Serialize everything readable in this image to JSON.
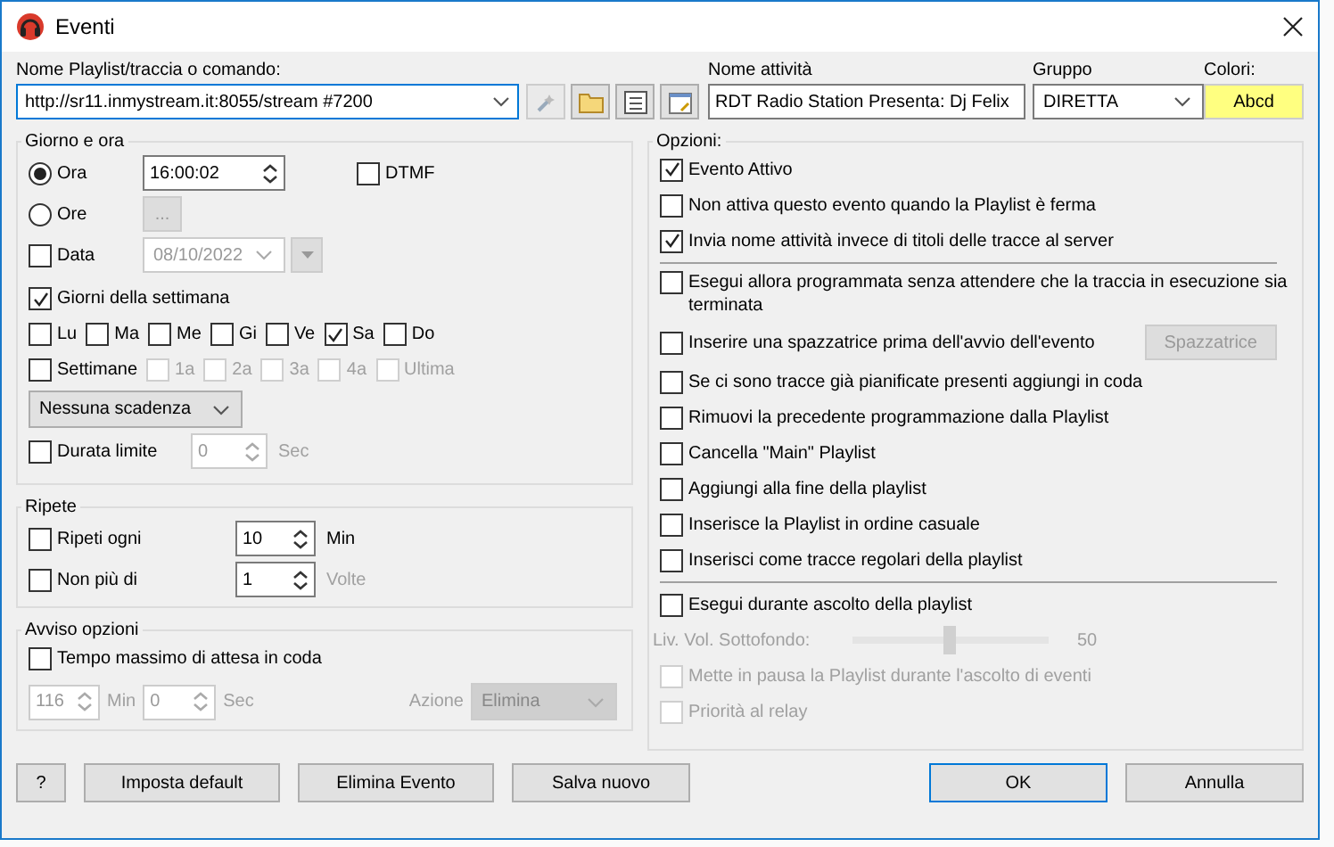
{
  "window": {
    "title": "Eventi"
  },
  "command": {
    "label": "Nome Playlist/traccia o comando:",
    "value": "http://sr11.inmystream.it:8055/stream #7200"
  },
  "activity": {
    "label": "Nome attività",
    "value": "RDT Radio Station Presenta: Dj Felix"
  },
  "group": {
    "label": "Gruppo",
    "value": "DIRETTA"
  },
  "colors": {
    "label": "Colori:",
    "sample": "Abcd"
  },
  "schedule": {
    "title": "Giorno e ora",
    "ora": {
      "label": "Ora",
      "selected": true,
      "value": "16:00:02"
    },
    "ore": {
      "label": "Ore",
      "selected": false,
      "button": "...",
      "button_disabled": true
    },
    "dtmf": {
      "label": "DTMF",
      "checked": false
    },
    "data": {
      "label": "Data",
      "checked": false,
      "value": "08/10/2022",
      "inputs_disabled": true
    },
    "weekdays": {
      "label": "Giorni della settimana",
      "checked": true
    },
    "days": [
      {
        "label": "Lu",
        "checked": false
      },
      {
        "label": "Ma",
        "checked": false
      },
      {
        "label": "Me",
        "checked": false
      },
      {
        "label": "Gi",
        "checked": false
      },
      {
        "label": "Ve",
        "checked": false
      },
      {
        "label": "Sa",
        "checked": true
      },
      {
        "label": "Do",
        "checked": false
      }
    ],
    "weeks": {
      "label": "Settimane",
      "checked": false,
      "items": [
        {
          "label": "1a",
          "checked": false,
          "disabled": true
        },
        {
          "label": "2a",
          "checked": false,
          "disabled": true
        },
        {
          "label": "3a",
          "checked": false,
          "disabled": true
        },
        {
          "label": "4a",
          "checked": false,
          "disabled": true
        },
        {
          "label": "Ultima",
          "checked": false,
          "disabled": true
        }
      ]
    },
    "expiry": {
      "value": "Nessuna scadenza"
    },
    "duration": {
      "label": "Durata limite",
      "checked": false,
      "value": "0",
      "unit": "Sec",
      "inputs_disabled": true
    }
  },
  "repeat": {
    "title": "Ripete",
    "rows": [
      {
        "label": "Ripeti ogni",
        "checked": false,
        "value": "10",
        "unit": "Min",
        "unit_disabled": false
      },
      {
        "label": "Non più di",
        "checked": false,
        "value": "1",
        "unit": "Volte",
        "unit_disabled": true
      }
    ]
  },
  "notice": {
    "title": "Avviso opzioni",
    "wait": {
      "label": "Tempo massimo di attesa in coda",
      "checked": false
    },
    "inputs_disabled": true,
    "minutes": {
      "value": "116",
      "unit": "Min"
    },
    "seconds": {
      "value": "0",
      "unit": "Sec"
    },
    "action": {
      "label": "Azione",
      "value": "Elimina"
    }
  },
  "options": {
    "title": "Opzioni:",
    "items": [
      {
        "kind": "check",
        "label": "Evento Attivo",
        "checked": true,
        "disabled": false
      },
      {
        "kind": "check",
        "label": "Non attiva questo evento quando la Playlist è ferma",
        "checked": false,
        "disabled": false
      },
      {
        "kind": "check",
        "label": "Invia nome attività invece di titoli delle tracce al server",
        "checked": true,
        "disabled": false
      },
      {
        "kind": "separator"
      },
      {
        "kind": "check",
        "label": "Esegui allora programmata senza attendere che la traccia in esecuzione sia terminata",
        "checked": false,
        "disabled": false
      },
      {
        "kind": "check_button",
        "label": "Inserire una spazzatrice prima dell'avvio dell'evento",
        "checked": false,
        "disabled": false,
        "button": "Spazzatrice",
        "button_disabled": true
      },
      {
        "kind": "check",
        "label": "Se ci sono tracce già pianificate presenti aggiungi in coda",
        "checked": false,
        "disabled": false
      },
      {
        "kind": "check",
        "label": "Rimuovi la precedente programmazione dalla Playlist",
        "checked": false,
        "disabled": false
      },
      {
        "kind": "check",
        "label": "Cancella \"Main\" Playlist",
        "checked": false,
        "disabled": false
      },
      {
        "kind": "check",
        "label": "Aggiungi alla fine della playlist",
        "checked": false,
        "disabled": false
      },
      {
        "kind": "check",
        "label": "Inserisce la Playlist in ordine casuale",
        "checked": false,
        "disabled": false
      },
      {
        "kind": "check",
        "label": "Inserisci come tracce regolari della playlist",
        "checked": false,
        "disabled": false
      },
      {
        "kind": "separator"
      },
      {
        "kind": "check",
        "label": "Esegui durante ascolto della playlist",
        "checked": false,
        "disabled": false
      },
      {
        "kind": "slider",
        "label": "Liv. Vol. Sottofondo:",
        "level": 0.5,
        "reading": "50",
        "disabled": true
      },
      {
        "kind": "check",
        "label": "Mette in pausa la Playlist durante l'ascolto di eventi",
        "checked": false,
        "disabled": true
      },
      {
        "kind": "check",
        "label": "Priorità al relay",
        "checked": false,
        "disabled": true
      }
    ]
  },
  "buttons_left": [
    {
      "label": "?"
    },
    {
      "label": "Imposta default"
    },
    {
      "label": "Elimina Evento"
    },
    {
      "label": "Salva nuovo"
    }
  ],
  "buttons_right": [
    {
      "label": "OK",
      "default": true
    },
    {
      "label": "Annulla",
      "default": false
    }
  ]
}
